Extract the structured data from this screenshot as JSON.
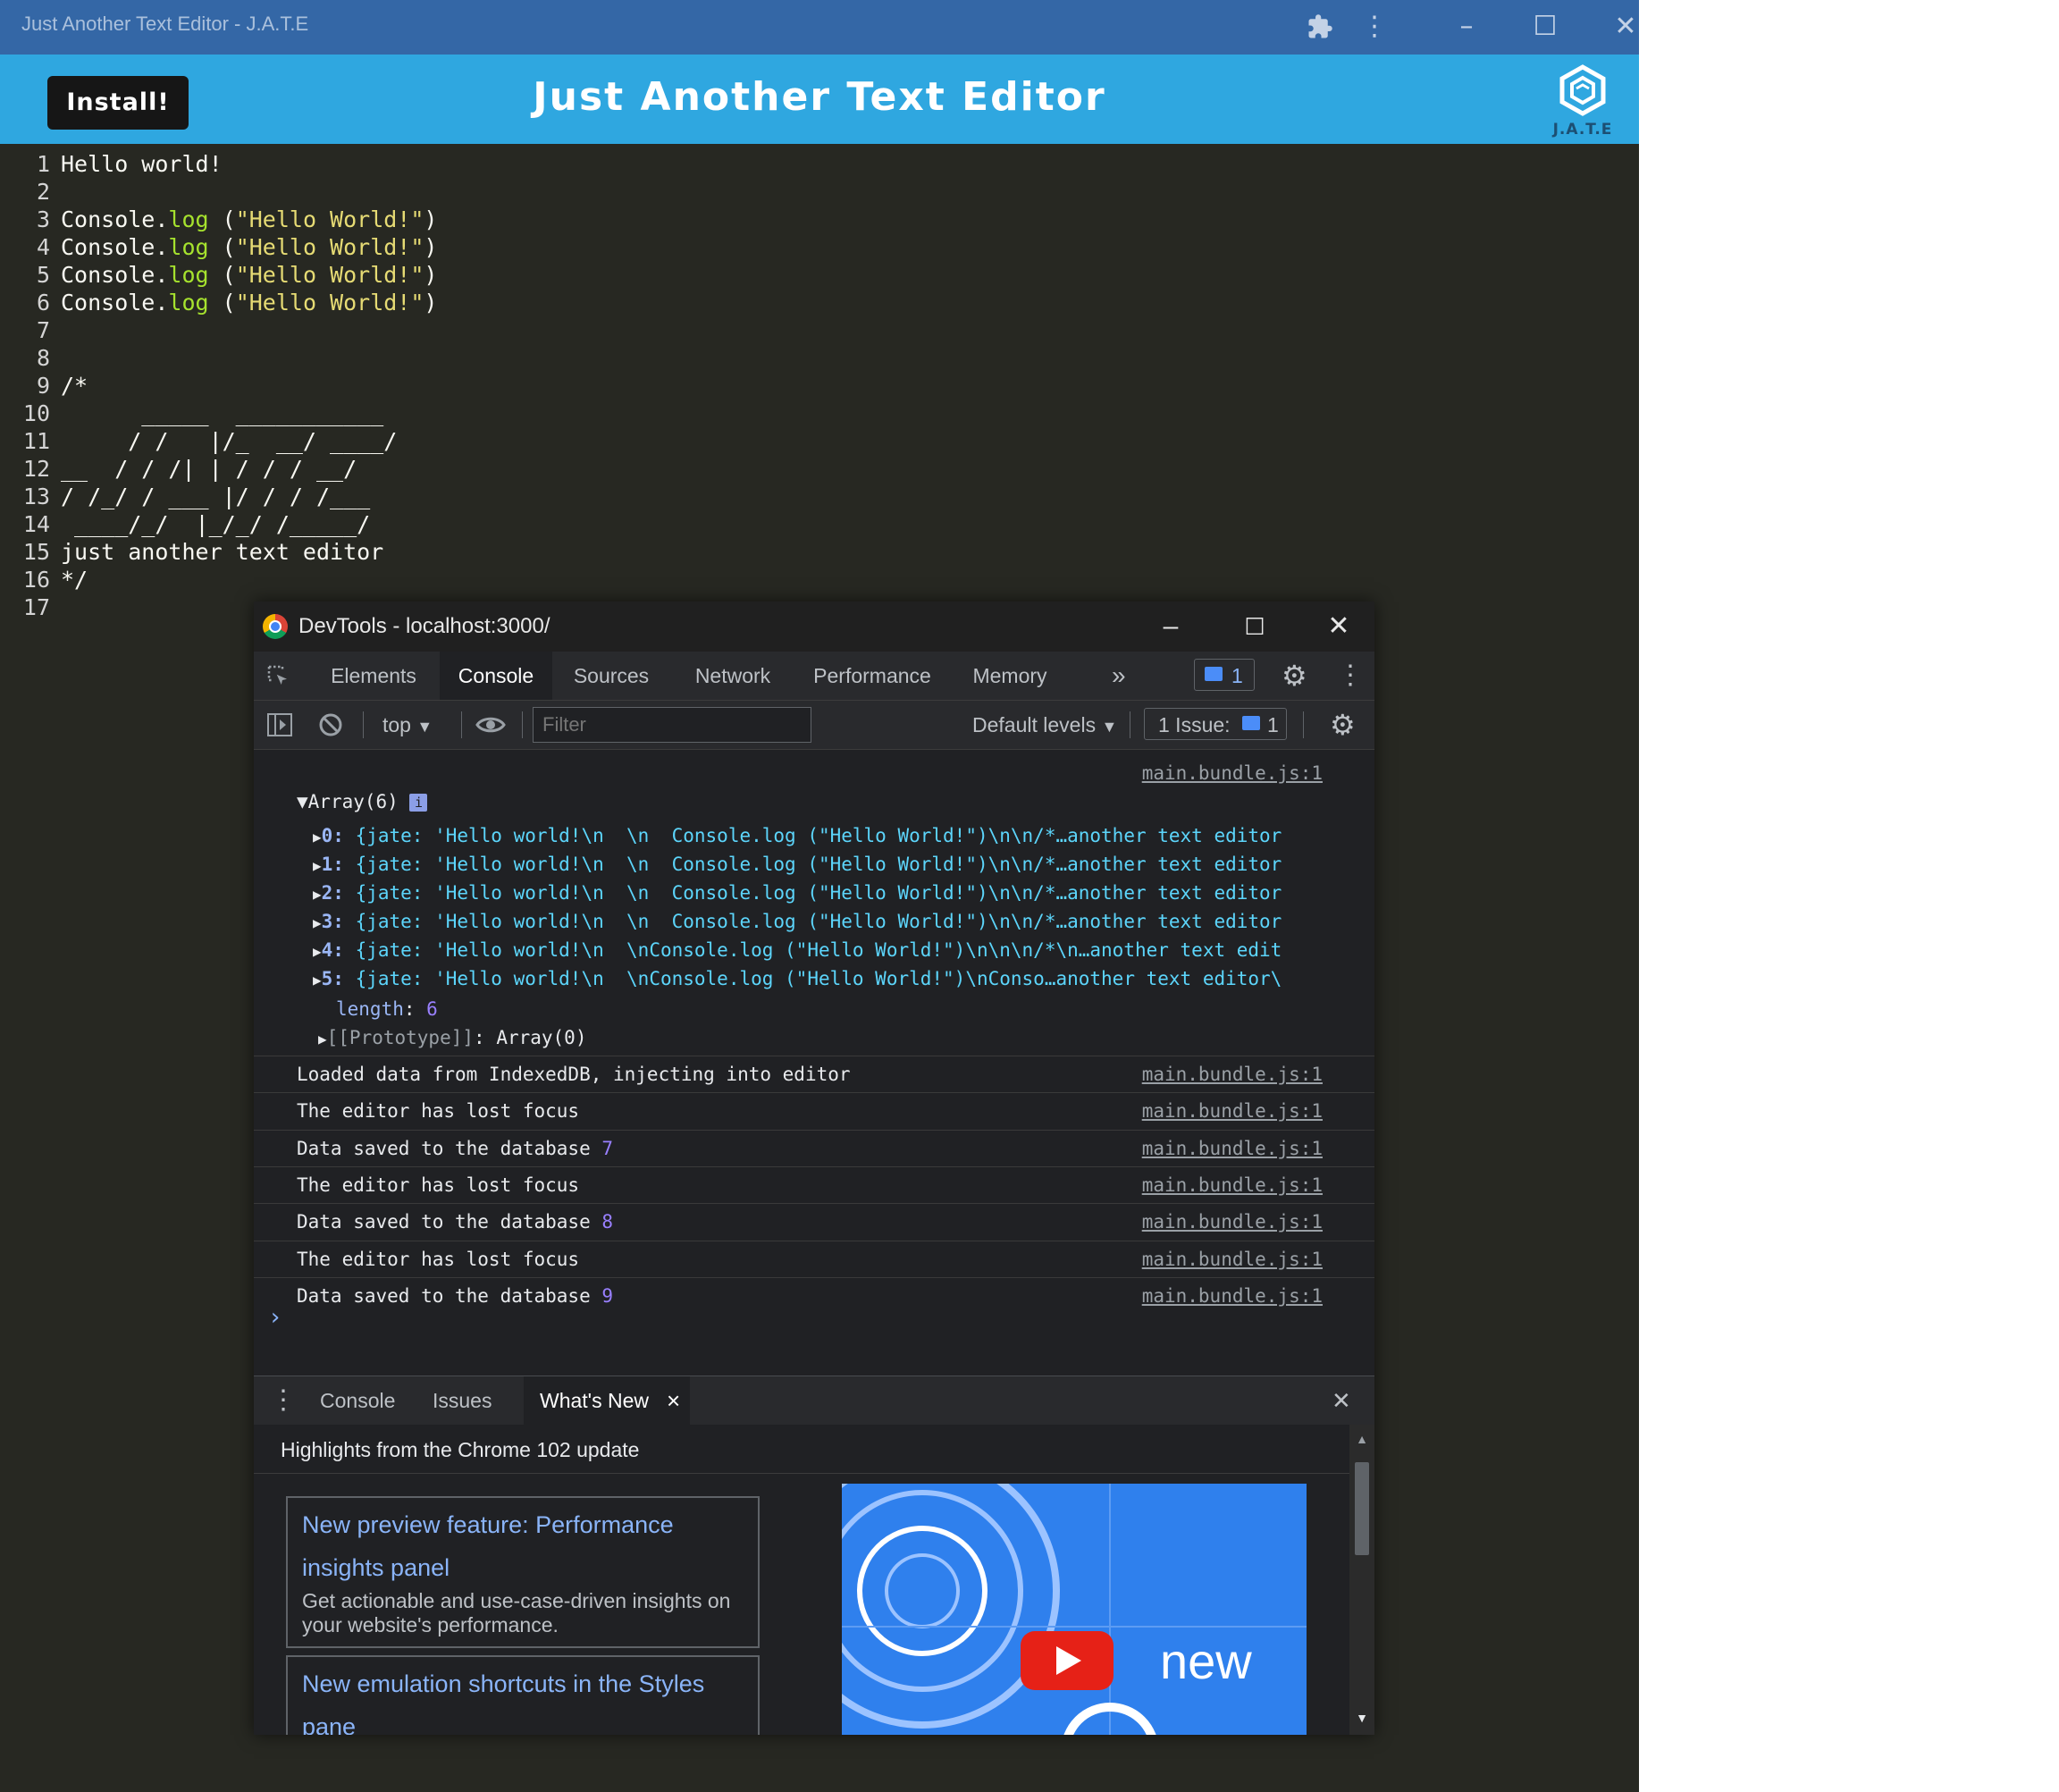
{
  "app": {
    "window_title": "Just Another Text Editor - J.A.T.E",
    "install_label": "Install!",
    "heading": "Just Another Text Editor",
    "logo_text": "J.A.T.E",
    "titlebar_icons": {
      "extensions": "puzzle-icon",
      "menu": "kebab-icon",
      "minimize": "–",
      "maximize": "☐",
      "close": "✕"
    },
    "colors": {
      "titlebar": "#3467a6",
      "header": "#2fa7e0",
      "editor_bg": "#272822"
    }
  },
  "editor": {
    "lines": [
      {
        "n": "1",
        "text": "Hello world!"
      },
      {
        "n": "2",
        "text": ""
      },
      {
        "n": "3",
        "pre": "Console.",
        "log": "log",
        "mid": " (",
        "str": "\"Hello World!\"",
        "post": ")"
      },
      {
        "n": "4",
        "pre": "Console.",
        "log": "log",
        "mid": " (",
        "str": "\"Hello World!\"",
        "post": ")"
      },
      {
        "n": "5",
        "pre": "Console.",
        "log": "log",
        "mid": " (",
        "str": "\"Hello World!\"",
        "post": ")"
      },
      {
        "n": "6",
        "pre": "Console.",
        "log": "log",
        "mid": " (",
        "str": "\"Hello World!\"",
        "post": ")"
      },
      {
        "n": "7",
        "text": ""
      },
      {
        "n": "8",
        "text": ""
      },
      {
        "n": "9",
        "comment": "/*"
      },
      {
        "n": "10",
        "comment": "      _____  ___________"
      },
      {
        "n": "11",
        "comment": "     / /   |/_  __/ ____/"
      },
      {
        "n": "12",
        "comment": "__  / / /| | / / / __/"
      },
      {
        "n": "13",
        "comment": "/ /_/ / ___ |/ / / /___"
      },
      {
        "n": "14",
        "comment": " ____/_/  |_/_/ /_____/"
      },
      {
        "n": "15",
        "comment": "just another text editor"
      },
      {
        "n": "16",
        "comment": "*/"
      },
      {
        "n": "17",
        "text": ""
      }
    ]
  },
  "devtools": {
    "title": "DevTools - localhost:3000/",
    "tabs": [
      "Elements",
      "Console",
      "Sources",
      "Network",
      "Performance",
      "Memory"
    ],
    "active_tab": "Console",
    "more_tabs": "»",
    "messages_badge": "1",
    "toolbar": {
      "context": "top",
      "filter_placeholder": "Filter",
      "levels": "Default levels",
      "issues_label": "1 Issue:",
      "issues_count": "1"
    },
    "console": {
      "first_source": "main.bundle.js:1",
      "array_label": "Array(6)",
      "array_info": "i",
      "entries": [
        {
          "key": "0:",
          "value": "{jate: 'Hello world!\\n  \\n  Console.log (\"Hello World!\")\\n\\n/*…another text editor"
        },
        {
          "key": "1:",
          "value": "{jate: 'Hello world!\\n  \\n  Console.log (\"Hello World!\")\\n\\n/*…another text editor"
        },
        {
          "key": "2:",
          "value": "{jate: 'Hello world!\\n  \\n  Console.log (\"Hello World!\")\\n\\n/*…another text editor"
        },
        {
          "key": "3:",
          "value": "{jate: 'Hello world!\\n  \\n  Console.log (\"Hello World!\")\\n\\n/*…another text editor"
        },
        {
          "key": "4:",
          "value": "{jate: 'Hello world!\\n  \\nConsole.log (\"Hello World!\")\\n\\n\\n/*\\n…another text edit"
        },
        {
          "key": "5:",
          "value": "{jate: 'Hello world!\\n  \\nConsole.log (\"Hello World!\")\\nConso…another text editor\\"
        }
      ],
      "length_label": "length",
      "length_value": "6",
      "prototype_label": "[[Prototype]]",
      "prototype_value": "Array(0)",
      "logs": [
        {
          "text": "Loaded data from IndexedDB, injecting into editor",
          "num": "",
          "source": "main.bundle.js:1"
        },
        {
          "text": "The editor has lost focus",
          "num": "",
          "source": "main.bundle.js:1"
        },
        {
          "text": "Data saved to the database",
          "num": "7",
          "source": "main.bundle.js:1"
        },
        {
          "text": "The editor has lost focus",
          "num": "",
          "source": "main.bundle.js:1"
        },
        {
          "text": "Data saved to the database",
          "num": "8",
          "source": "main.bundle.js:1"
        },
        {
          "text": "The editor has lost focus",
          "num": "",
          "source": "main.bundle.js:1"
        },
        {
          "text": "Data saved to the database",
          "num": "9",
          "source": "main.bundle.js:1"
        }
      ],
      "prompt": "›"
    },
    "drawer": {
      "tabs": [
        "Console",
        "Issues",
        "What's New"
      ],
      "active_tab": "What's New",
      "close_tab": "×",
      "close_drawer": "✕",
      "highlights_title": "Highlights from the Chrome 102 update",
      "cards": [
        {
          "title": "New preview feature: Performance insights panel",
          "desc": "Get actionable and use-case-driven insights on your website's performance."
        },
        {
          "title": "New emulation shortcuts in the Styles pane",
          "desc": ""
        }
      ],
      "video_text": "new"
    }
  }
}
